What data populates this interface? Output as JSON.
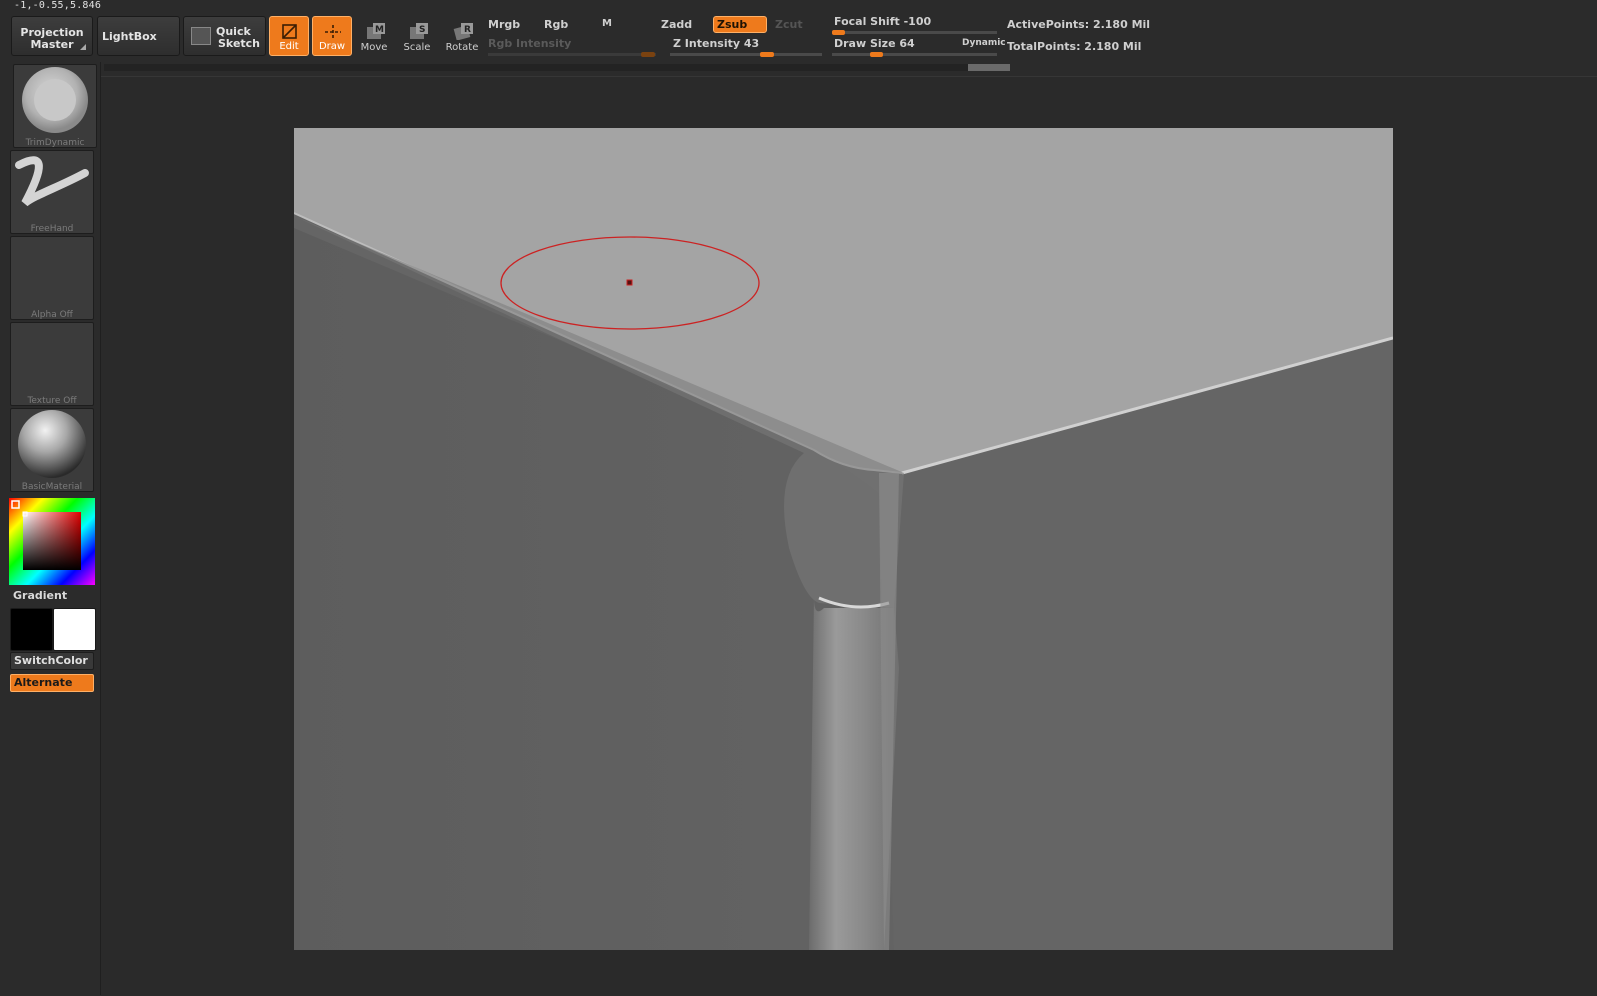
{
  "status": {
    "coordinates": "-1,-0.55,5.846"
  },
  "toolbar": {
    "projection_master": {
      "line1": "Projection",
      "line2": "Master"
    },
    "lightbox": "LightBox",
    "quick_sketch": {
      "line1": "Quick",
      "line2": "Sketch"
    },
    "tools": [
      {
        "label": "Edit",
        "icon": "edit-icon",
        "active": true
      },
      {
        "label": "Draw",
        "icon": "draw-icon",
        "active": true
      },
      {
        "label": "Move",
        "icon": "move-icon",
        "active": false
      },
      {
        "label": "Scale",
        "icon": "scale-icon",
        "active": false
      },
      {
        "label": "Rotate",
        "icon": "rotate-icon",
        "active": false
      }
    ],
    "mrgb": "Mrgb",
    "rgb": "Rgb",
    "m": "M",
    "zadd": "Zadd",
    "zsub": "Zsub",
    "zcut": "Zcut",
    "rgb_intensity": "Rgb  Intensity",
    "z_intensity": {
      "label": "Z Intensity",
      "value": "43"
    },
    "focal_shift": {
      "label": "Focal  Shift",
      "value": "-100"
    },
    "draw_size": {
      "label": "Draw  Size",
      "value": "64"
    },
    "dynamic": "Dynamic",
    "active_points": "ActivePoints: 2.180  Mil",
    "total_points": "TotalPoints: 2.180  Mil"
  },
  "sidebar": {
    "brush": "TrimDynamic",
    "stroke": "FreeHand",
    "alpha": "Alpha  Off",
    "texture": "Texture  Off",
    "material": "BasicMaterial",
    "gradient": "Gradient",
    "switch_color": "SwitchColor",
    "alternate": "Alternate"
  },
  "colors": {
    "accent": "#ee7a1c",
    "brush_circle": "#cc2222",
    "main_color": "#000000",
    "secondary_color": "#ffffff"
  }
}
